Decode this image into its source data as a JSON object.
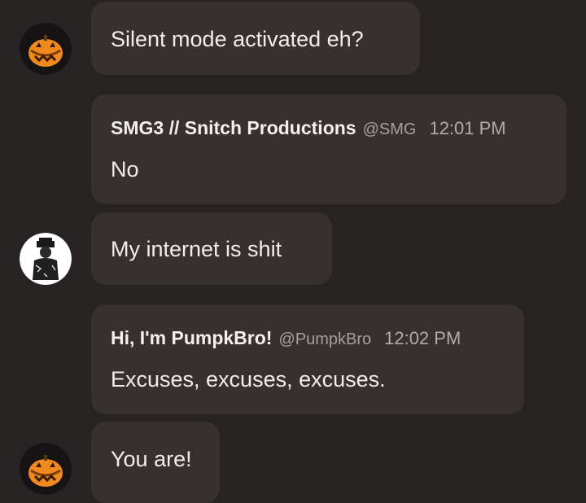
{
  "messages": [
    {
      "text": "Silent mode activated eh?"
    },
    {
      "name": "SMG3 // Snitch Productions",
      "handle": "@SMG",
      "time": "12:01 PM",
      "text": "No"
    },
    {
      "text": "My internet is shit"
    },
    {
      "name": "Hi, I'm PumpkBro!",
      "handle": "@PumpkBro",
      "time": "12:02 PM",
      "text": "Excuses, excuses, excuses."
    },
    {
      "text": "You are!"
    }
  ],
  "colors": {
    "background": "#272322",
    "bubble": "#363130",
    "pumpkin": "#f08a1e"
  },
  "avatars": [
    "pumpkin-avatar",
    "hooded-figure-avatar",
    "pumpkin-avatar"
  ]
}
